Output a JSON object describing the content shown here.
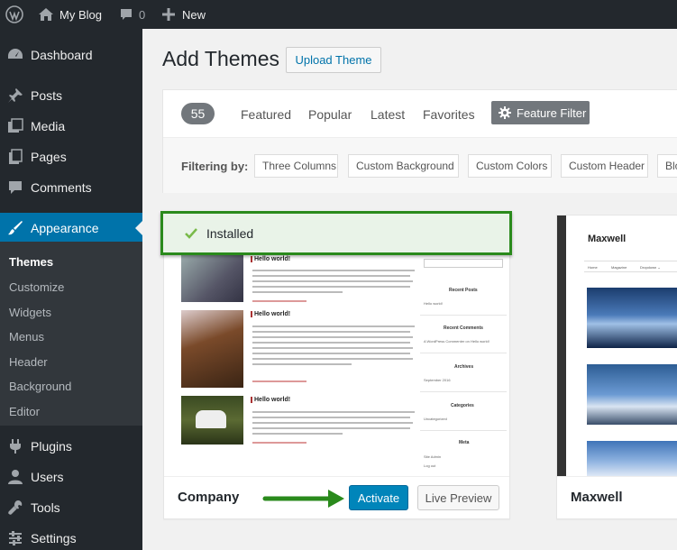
{
  "admin_bar": {
    "site_name": "My Blog",
    "comments_count": "0",
    "new_label": "New"
  },
  "menu": {
    "dashboard": "Dashboard",
    "posts": "Posts",
    "media": "Media",
    "pages": "Pages",
    "comments": "Comments",
    "appearance": "Appearance",
    "plugins": "Plugins",
    "users": "Users",
    "tools": "Tools",
    "settings": "Settings",
    "submenu": {
      "themes": "Themes",
      "customize": "Customize",
      "widgets": "Widgets",
      "menus": "Menus",
      "header": "Header",
      "background": "Background",
      "editor": "Editor"
    }
  },
  "header": {
    "title": "Add Themes",
    "upload_label": "Upload Theme"
  },
  "filter": {
    "count": "55",
    "tabs": {
      "featured": "Featured",
      "popular": "Popular",
      "latest": "Latest",
      "favorites": "Favorites"
    },
    "feature_filter_label": "Feature Filter",
    "filtering_by_label": "Filtering by:",
    "tags": {
      "three_columns": "Three Columns",
      "custom_background": "Custom Background",
      "custom_colors": "Custom Colors",
      "custom_header": "Custom Header",
      "blog": "Blo"
    }
  },
  "notice": {
    "installed": "Installed"
  },
  "themes": {
    "company": {
      "name": "Company",
      "activate_label": "Activate",
      "preview_label": "Live Preview",
      "posts": {
        "p1": "Hello world!",
        "p2": "Hello world!",
        "p3": "Hello world!"
      },
      "widgets": {
        "recent_posts": "Recent Posts",
        "hello": "Hello world!",
        "recent_comments": "Recent Comments",
        "commenter": "A WordPress Commenter on Hello world!",
        "archives": "Archives",
        "archive_month": "September 2016",
        "categories": "Categories",
        "uncategorized": "Uncategorized",
        "meta": "Meta",
        "site_admin": "Site Admin",
        "log_out": "Log out"
      }
    },
    "maxwell": {
      "name": "Maxwell",
      "brand": "Maxwell",
      "nav": {
        "home": "Home",
        "magazine": "Magazine",
        "dropdown": "Dropdown ⌄"
      }
    }
  },
  "colors": {
    "admin_dark": "#23282d",
    "submenu_dark": "#32373c",
    "primary_blue": "#0073aa",
    "button_blue": "#0085ba",
    "highlight_green": "#2a8a1c",
    "notice_bg": "#e9f3e8"
  }
}
